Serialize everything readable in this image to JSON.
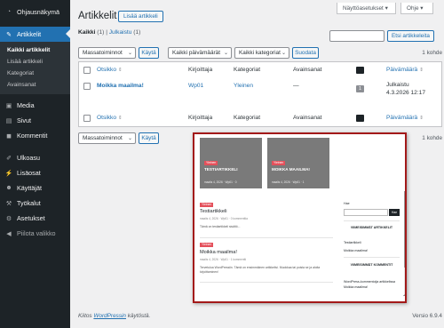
{
  "sidebar": {
    "items": [
      {
        "label": "Ohjausnäkymä",
        "icon": "dashboard-icon"
      },
      {
        "label": "Artikkelit",
        "icon": "pin-icon"
      },
      {
        "label": "Media",
        "icon": "media-icon"
      },
      {
        "label": "Sivut",
        "icon": "page-icon"
      },
      {
        "label": "Kommentit",
        "icon": "comment-icon"
      },
      {
        "label": "Ulkoasu",
        "icon": "brush-icon"
      },
      {
        "label": "Lisäosat",
        "icon": "plugin-icon"
      },
      {
        "label": "Käyttäjät",
        "icon": "users-icon"
      },
      {
        "label": "Työkalut",
        "icon": "wrench-icon"
      },
      {
        "label": "Asetukset",
        "icon": "settings-icon"
      },
      {
        "label": "Piilota valikko",
        "icon": "collapse-icon"
      }
    ],
    "submenu": [
      "Kaikki artikkelit",
      "Lisää artikkeli",
      "Kategoriat",
      "Avainsanat"
    ]
  },
  "header": {
    "screen_options": "Näyttöasetukset ▾",
    "help": "Ohje ▾",
    "title": "Artikkelit",
    "add_new": "Lisää artikkeli"
  },
  "filters": {
    "all_label": "Kaikki",
    "all_count": "(1)",
    "separator": "|",
    "published_label": "Julkaistu",
    "published_count": "(1)",
    "search_button": "Etsi artikkeleita",
    "bulk_actions": "Massatoiminnot",
    "apply": "Käytä",
    "all_dates": "Kaikki päivämäärät",
    "all_categories": "Kaikki kategoriat",
    "filter_button": "Suodata",
    "item_count": "1 kohde"
  },
  "table": {
    "columns": {
      "title": "Otsikko",
      "author": "Kirjoittaja",
      "categories": "Kategoriat",
      "tags": "Avainsanat",
      "date": "Päivämäärä"
    },
    "rows": [
      {
        "title": "Moikka maailma!",
        "author": "Wp01",
        "category": "Yleinen",
        "tags": "—",
        "comments": "1",
        "date_status": "Julkaistu",
        "date": "4.3.2026 12:17"
      }
    ]
  },
  "footer": {
    "thanks_prefix": "Kiitos ",
    "wordpress_link": "WordPressin",
    "thanks_suffix": " käytöstä.",
    "version": "Versio 6.9.4"
  },
  "preview": {
    "cards": [
      {
        "tag": "Yleinen",
        "title": "TESTIARTIKKELI",
        "meta": "maalis 4, 2026  ·  Wp01  ·  0"
      },
      {
        "tag": "Yleinen",
        "title": "MOIKKA MAAILMA!",
        "meta": "maalis 4, 2026  ·  Wp01  ·  1"
      }
    ],
    "posts": [
      {
        "category": "Yleinen",
        "title": "Testiartikkeli",
        "meta": "maalis 4, 2026  ·  Wp01  ·  0 kommenttia",
        "excerpt": "Tämä on testiartikkeli sisältö..."
      },
      {
        "category": "Yleinen",
        "title": "Moikka maailma!",
        "meta": "maalis 4, 2026  ·  Wp01  ·  1 kommentti",
        "excerpt": "Tervetuloa WordPressiin. Tämä on ensimmäinen artikkelisi. Muokkaa tai poista se ja aloita kirjoittaminen!"
      }
    ],
    "sidebar": {
      "search_label": "Hae",
      "search_button": "Hae",
      "recent_posts_title": "VIIMEISIMMÄT ARTIKKELIT",
      "recent_posts": [
        "Testiartikkeli",
        "Moikka maailma!"
      ],
      "recent_comments_title": "VIIMEISIMMÄT KOMMENTIT",
      "recent_comment": "WordPress-kommentoija artikkelissa",
      "recent_comment_post": "Moikka maailma!"
    }
  },
  "colors": {
    "admin_bar": "#1d2327",
    "accent": "#2271b1",
    "popup_border": "#a31919",
    "preview_tag": "#e4505b"
  }
}
